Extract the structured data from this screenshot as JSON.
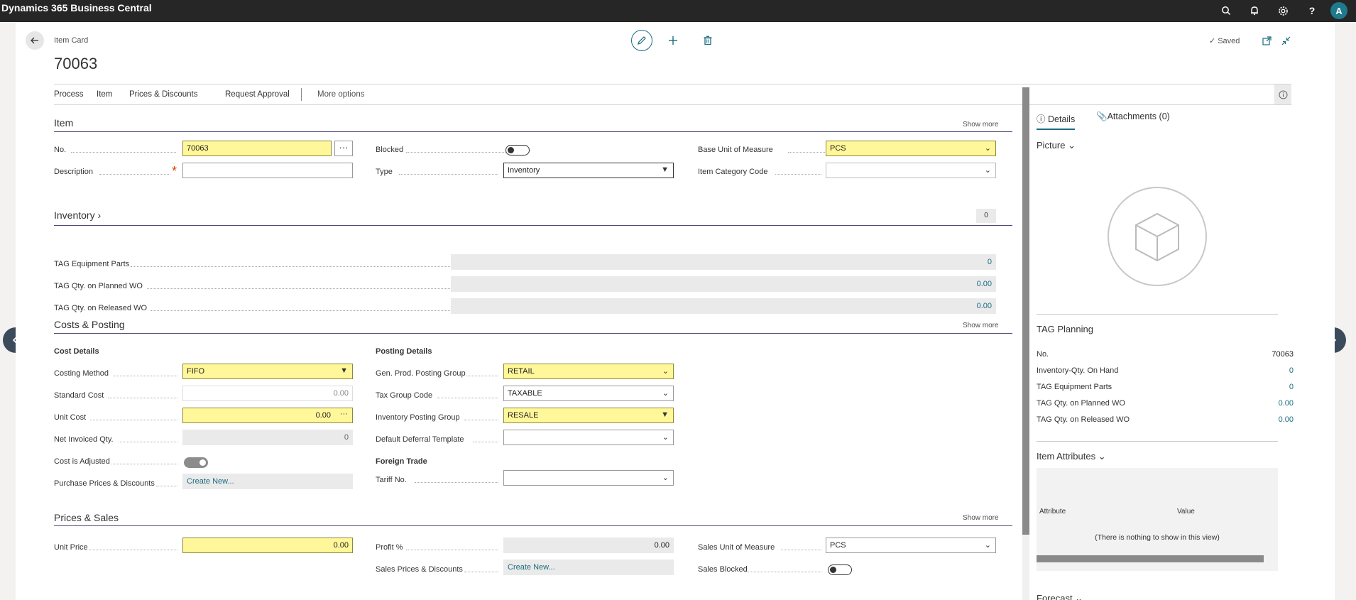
{
  "app": {
    "title": "Dynamics 365 Business Central",
    "avatar_initial": "A"
  },
  "topbar_icons": [
    "search-icon",
    "bell-icon",
    "gear-icon",
    "help-icon"
  ],
  "header": {
    "breadcrumb": "Item Card",
    "title": "70063",
    "saved_label": "Saved",
    "actions": [
      "edit-icon",
      "add-icon",
      "delete-icon"
    ]
  },
  "actionbar": {
    "items": [
      "Process",
      "Item",
      "Prices & Discounts",
      "Request Approval"
    ],
    "more": "More options"
  },
  "show_more": "Show more",
  "item": {
    "title": "Item",
    "no_label": "No.",
    "no_value": "70063",
    "ellipsis": "···",
    "description_label": "Description",
    "required_mark": "*",
    "description_value": "",
    "blocked_label": "Blocked",
    "blocked": false,
    "type_label": "Type",
    "type_value": "Inventory",
    "base_uom_label": "Base Unit of Measure",
    "base_uom_value": "PCS",
    "item_category_label": "Item Category Code",
    "item_category_value": ""
  },
  "inventory": {
    "title": "Inventory",
    "badge": "0",
    "rows": [
      {
        "label": "TAG Equipment Parts",
        "value": "0"
      },
      {
        "label": "TAG Qty. on Planned WO",
        "value": "0.00"
      },
      {
        "label": "TAG Qty. on Released WO",
        "value": "0.00"
      }
    ]
  },
  "costs": {
    "title": "Costs & Posting",
    "cost_details": "Cost Details",
    "costing_method_label": "Costing Method",
    "costing_method_value": "FIFO",
    "standard_cost_label": "Standard Cost",
    "standard_cost_value": "0.00",
    "unit_cost_label": "Unit Cost",
    "unit_cost_value": "0.00",
    "net_invoiced_label": "Net Invoiced Qty.",
    "net_invoiced_value": "0",
    "cost_adjusted_label": "Cost is Adjusted",
    "cost_adjusted": true,
    "purchase_prices_label": "Purchase Prices & Discounts",
    "create_new": "Create New...",
    "posting_details": "Posting Details",
    "gen_prod_label": "Gen. Prod. Posting Group",
    "gen_prod_value": "RETAIL",
    "tax_group_label": "Tax Group Code",
    "tax_group_value": "TAXABLE",
    "inv_posting_label": "Inventory Posting Group",
    "inv_posting_value": "RESALE",
    "deferral_label": "Default Deferral Template",
    "deferral_value": "",
    "foreign_trade": "Foreign Trade",
    "tariff_label": "Tariff No.",
    "tariff_value": ""
  },
  "prices": {
    "title": "Prices & Sales",
    "unit_price_label": "Unit Price",
    "unit_price_value": "0.00",
    "profit_label": "Profit %",
    "profit_value": "0.00",
    "sales_prices_label": "Sales Prices & Discounts",
    "create_new": "Create New...",
    "sales_uom_label": "Sales Unit of Measure",
    "sales_uom_value": "PCS",
    "sales_blocked_label": "Sales Blocked",
    "sales_blocked": false
  },
  "sidebar": {
    "tabs": [
      "Details",
      "Attachments (0)"
    ],
    "picture_title": "Picture",
    "tag_planning_title": "TAG Planning",
    "tag_planning_rows": [
      {
        "label": "No.",
        "value": "70063"
      },
      {
        "label": "Inventory-Qty. On Hand",
        "value": "0"
      },
      {
        "label": "TAG Equipment Parts",
        "value": "0"
      },
      {
        "label": "TAG Qty. on Planned WO",
        "value": "0.00"
      },
      {
        "label": "TAG Qty. on Released WO",
        "value": "0.00"
      }
    ],
    "attributes_title": "Item Attributes",
    "attr_col_attribute": "Attribute",
    "attr_col_value": "Value",
    "attr_empty": "(There is nothing to show in this view)",
    "forecast_title": "Forecast"
  }
}
